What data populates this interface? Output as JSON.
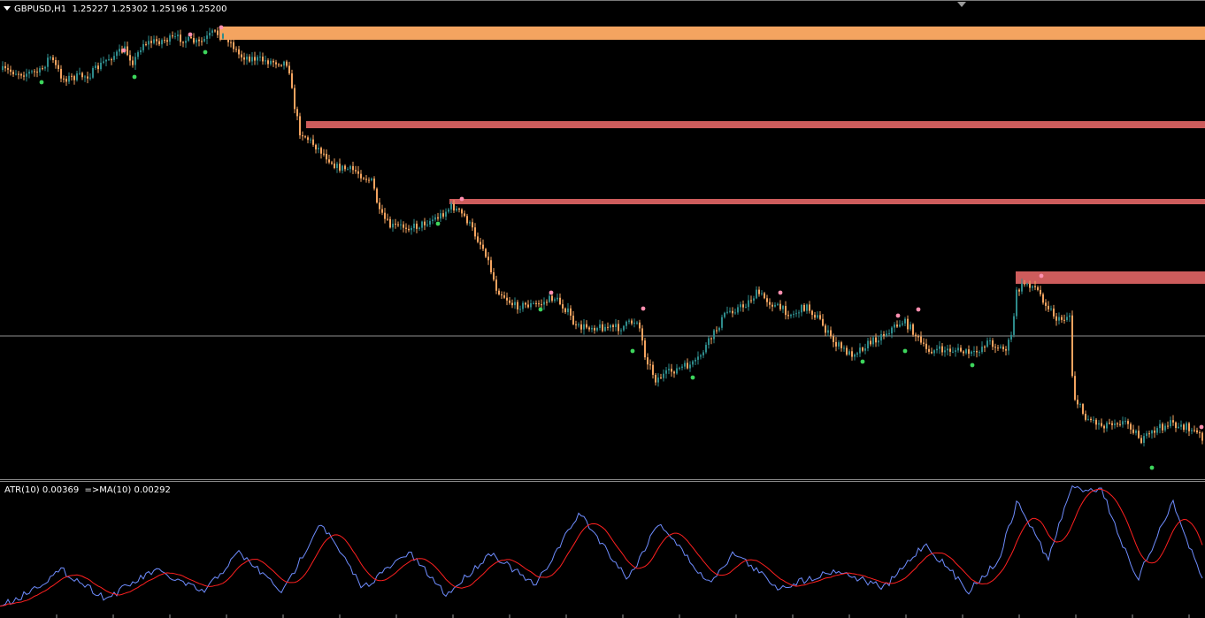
{
  "window": {
    "symbol": "GBPUSD,H1",
    "open": "1.25227",
    "high": "1.25302",
    "low": "1.25196",
    "close": "1.25200"
  },
  "indicator": {
    "text": "ATR(10) 0.00369  =>MA(10) 0.00292",
    "atr_value": 0.00369,
    "ma_value": 0.00292
  },
  "colors": {
    "background": "#000000",
    "bull_candle": "#2e8b8b",
    "bear_candle": "#f4a460",
    "zone_top": "#f4a460",
    "zone_other": "#cd5c5c",
    "fractal_up": "#ff8fb0",
    "fractal_down": "#3dd65c",
    "atr_line": "#6f8dff",
    "ma_line": "#ff2020",
    "crosshair": "#c0c0c0"
  },
  "chart_data": {
    "type": "candlestick",
    "symbol": "GBPUSD",
    "timeframe": "H1",
    "last_bar": {
      "open": 1.25227,
      "high": 1.25302,
      "low": 1.25196,
      "close": 1.252
    },
    "indicator_panel": {
      "name": "ATR(10)",
      "atr_last": 0.00369,
      "ma_period": 10,
      "ma_last": 0.00292
    }
  }
}
